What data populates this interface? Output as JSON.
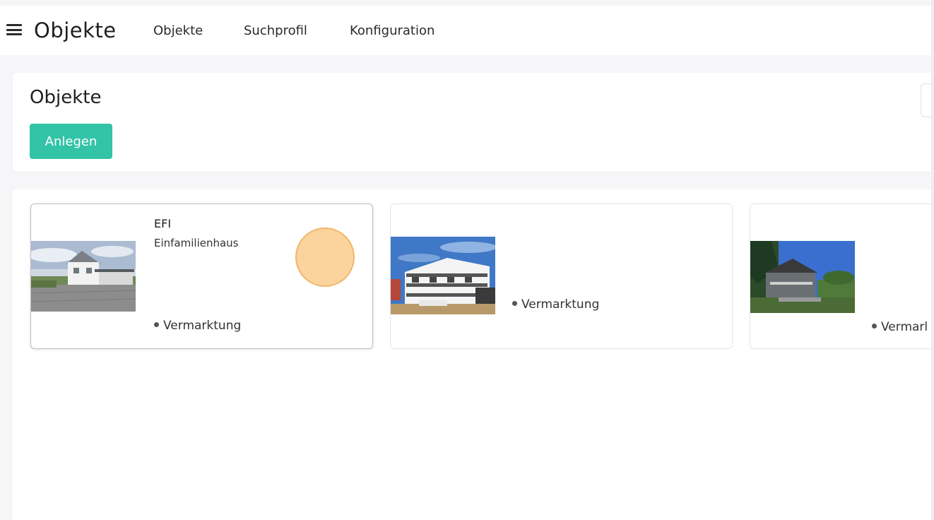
{
  "app": {
    "title": "Objekte",
    "nav": [
      "Objekte",
      "Suchprofil",
      "Konfiguration"
    ]
  },
  "header": {
    "title": "Objekte",
    "create_label": "Anlegen"
  },
  "objects": [
    {
      "title": "EFI",
      "subtitle": "Einfamilienhaus",
      "status": "Vermarktung",
      "image": "white-single-family-house"
    },
    {
      "title": "",
      "subtitle": "",
      "status": "Vermarktung",
      "image": "apartment-building"
    },
    {
      "title": "",
      "subtitle": "",
      "status": "Vermarl",
      "image": "wooden-house-with-trees"
    }
  ],
  "colors": {
    "accent": "#33c3a7",
    "click_indicator": "#fac882"
  }
}
